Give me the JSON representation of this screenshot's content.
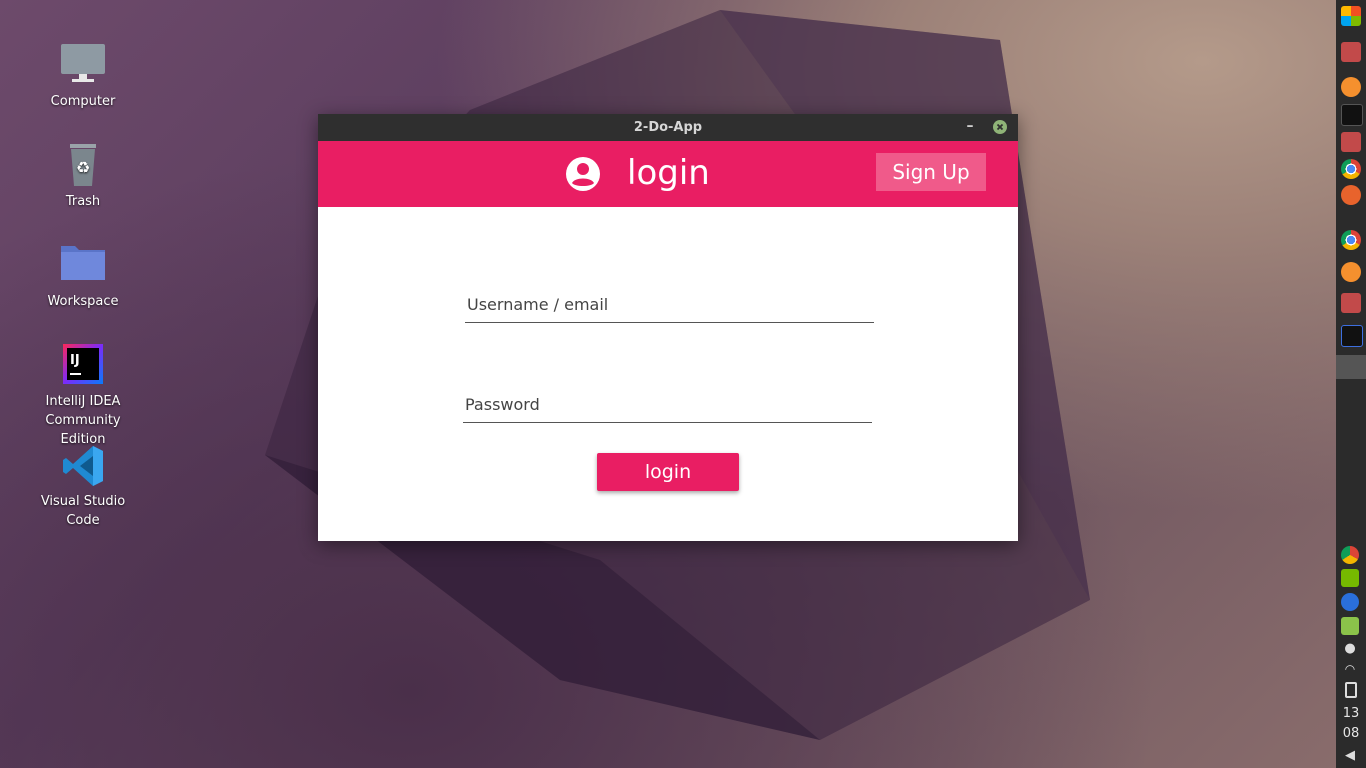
{
  "desktop": {
    "icons": [
      {
        "label": "Computer"
      },
      {
        "label": "Trash"
      },
      {
        "label": "Workspace"
      },
      {
        "label": "IntelliJ IDEA Community Edition"
      },
      {
        "label": "Visual Studio Code"
      }
    ]
  },
  "window": {
    "title": "2-Do-App",
    "minimize_label": "–",
    "header": {
      "title": "login",
      "signup_label": "Sign Up",
      "icon": "account-circle-icon"
    },
    "form": {
      "username_placeholder": "Username / email",
      "password_placeholder": "Password",
      "login_label": "login"
    }
  },
  "dock": {
    "clock_hour": "13",
    "clock_minute": "08"
  },
  "colors": {
    "accent": "#e91e63",
    "signup_bg": "#f05a8a",
    "titlebar": "#2f2f2f"
  }
}
